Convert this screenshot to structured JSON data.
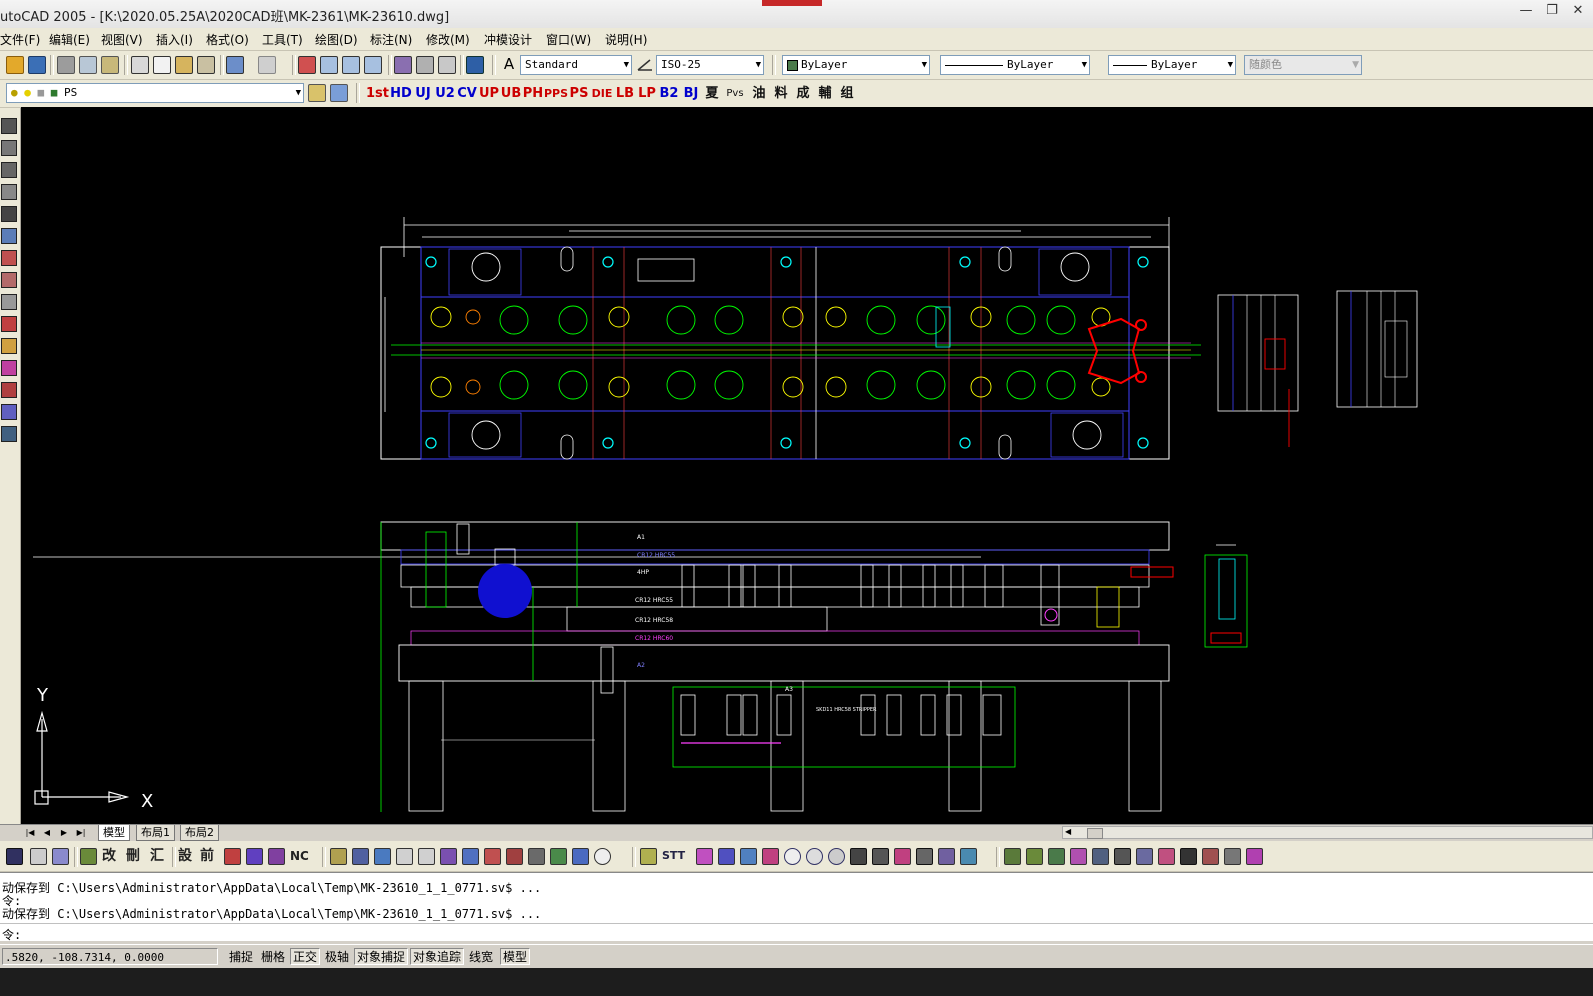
{
  "window": {
    "title": "utoCAD 2005 - [K:\\2020.05.25A\\2020CAD班\\MK-2361\\MK-23610.dwg]",
    "minimize": "—",
    "restore": "❐",
    "close": "✕"
  },
  "menu": [
    "文件(F)",
    "编辑(E)",
    "视图(V)",
    "插入(I)",
    "格式(O)",
    "工具(T)",
    "绘图(D)",
    "标注(N)",
    "修改(M)",
    "冲模设计",
    "窗口(W)",
    "说明(H)"
  ],
  "toolbar": {
    "text_style": "Standard",
    "dim_style": "ISO-25",
    "layer_color": "ByLayer",
    "linetype": "ByLayer",
    "lineweight": "ByLayer",
    "plot_style": "随颜色",
    "layer_name": "PS"
  },
  "custom_toolbar": [
    "1st",
    "HD",
    "UJ",
    "U2",
    "CV",
    "UP",
    "UB",
    "PH",
    "PPS",
    "PS",
    "DIE",
    "LB",
    "LP",
    "B2",
    "BJ",
    "夏",
    "Pvs",
    "油",
    "料",
    "成",
    "輔",
    "组"
  ],
  "bottom_toolbar_text": [
    "改",
    "刪",
    "汇",
    "設",
    "前",
    "NC",
    "STT"
  ],
  "drawing": {
    "ucs_x": "X",
    "ucs_y": "Y",
    "labels": {
      "a1": "A1",
      "cr12": "CR12 HRC55",
      "dh": "4HP",
      "cr12b": "CR12 HRC55",
      "cr12c": "CR12 HRC58",
      "hr": "CR12 HRC60",
      "a2": "A2",
      "a3": "A3",
      "stripper": "SKD11 HRC58   STRIPPER"
    }
  },
  "layout_tabs": [
    "模型",
    "布局1",
    "布局2"
  ],
  "command_lines": [
    "动保存到 C:\\Users\\Administrator\\AppData\\Local\\Temp\\MK-23610_1_1_0771.sv$ ...",
    "令:",
    "动保存到 C:\\Users\\Administrator\\AppData\\Local\\Temp\\MK-23610_1_1_0771.sv$ ..."
  ],
  "command_prompt": "令:",
  "status": {
    "coords": ".5820, -108.7314, 0.0000",
    "buttons": [
      {
        "label": "捕捉",
        "on": false
      },
      {
        "label": "栅格",
        "on": false
      },
      {
        "label": "正交",
        "on": true
      },
      {
        "label": "极轴",
        "on": false
      },
      {
        "label": "对象捕捉",
        "on": true
      },
      {
        "label": "对象追踪",
        "on": true
      },
      {
        "label": "线宽",
        "on": false
      },
      {
        "label": "模型",
        "on": true
      }
    ]
  },
  "colors": {
    "canvas": "#000000",
    "plate_outline": "#ffffff",
    "inner_outline": "#4040ff",
    "dimension": "#ff40ff",
    "hole_green": "#00ff00",
    "hole_yellow": "#ffff00",
    "cyan": "#00ffff",
    "red": "#ff0000"
  }
}
